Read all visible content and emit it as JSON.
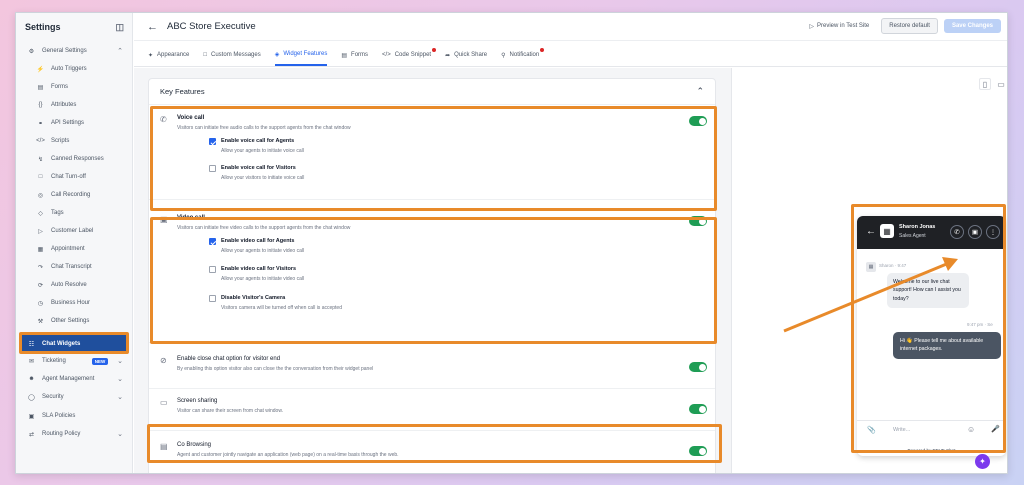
{
  "sidebar": {
    "title": "Settings",
    "items": [
      {
        "label": "General Settings",
        "icon": "gear-icon"
      },
      {
        "label": "Auto Triggers",
        "icon": "bolt-icon"
      },
      {
        "label": "Forms",
        "icon": "form-icon"
      },
      {
        "label": "Attributes",
        "icon": "braces-icon"
      },
      {
        "label": "API Settings",
        "icon": "api-icon"
      },
      {
        "label": "Scripts",
        "icon": "code-icon"
      },
      {
        "label": "Canned Responses",
        "icon": "lightning-icon"
      },
      {
        "label": "Chat Turn-off",
        "icon": "chat-icon"
      },
      {
        "label": "Call Recording",
        "icon": "record-icon"
      },
      {
        "label": "Tags",
        "icon": "tag-icon"
      },
      {
        "label": "Customer Label",
        "icon": "label-icon"
      },
      {
        "label": "Appointment",
        "icon": "calendar-icon"
      },
      {
        "label": "Chat Transcript",
        "icon": "transcript-icon"
      },
      {
        "label": "Auto Resolve",
        "icon": "resolve-icon"
      },
      {
        "label": "Business Hour",
        "icon": "clock-icon"
      },
      {
        "label": "Other Settings",
        "icon": "wrench-icon"
      },
      {
        "label": "Chat Widgets",
        "icon": "widget-icon"
      },
      {
        "label": "Ticketing",
        "icon": "ticket-icon",
        "badge": "NEW"
      },
      {
        "label": "Agent Management",
        "icon": "agents-icon"
      },
      {
        "label": "Security",
        "icon": "shield-icon"
      },
      {
        "label": "SLA Policies",
        "icon": "sla-icon"
      },
      {
        "label": "Routing Policy",
        "icon": "routing-icon"
      }
    ]
  },
  "header": {
    "title": "ABC Store Executive",
    "preview_label": "Preview in Test Site",
    "restore_label": "Restore default",
    "save_label": "Save Changes"
  },
  "tabs": [
    {
      "label": "Appearance"
    },
    {
      "label": "Custom Messages"
    },
    {
      "label": "Widget Features"
    },
    {
      "label": "Forms"
    },
    {
      "label": "Code Snippet"
    },
    {
      "label": "Quick Share"
    },
    {
      "label": "Notification"
    }
  ],
  "key_features": {
    "title": "Key Features",
    "voice": {
      "title": "Voice call",
      "desc": "Visitors can initiate free audio calls to the support agents from the chat window",
      "opt1_title": "Enable voice call for Agents",
      "opt1_desc": "Allow your agents to initiate voice call",
      "opt2_title": "Enable voice call for Visitors",
      "opt2_desc": "Allow your visitors to initiate voice call"
    },
    "video": {
      "title": "Video call",
      "desc": "Visitors can initiate free video calls to the support agents from the chat window",
      "opt1_title": "Enable video call for Agents",
      "opt1_desc": "Allow your agents to initiate video call",
      "opt2_title": "Enable video call for Visitors",
      "opt2_desc": "Allow your agents to initiate video call",
      "opt3_title": "Disable Visitor's Camera",
      "opt3_desc": "Visitors camera will be turned off when call is accepted"
    },
    "close_chat": {
      "title": "Enable close chat option for visitor end",
      "desc": "By enabling this option visitor also can close the the conversation from their widget panel"
    },
    "screen_sharing": {
      "title": "Screen sharing",
      "desc": "Visitor can share their screen from chat window."
    },
    "co_browsing": {
      "title": "Co Browsing",
      "desc": "Agent and customer jointly navigate an application (web page) on a real-time basis through the web."
    }
  },
  "widget": {
    "agent_name": "Sharon Jonas",
    "agent_role": "Sales Agent",
    "msg_in_meta": "Sharon · 9:47",
    "msg_in": "Welcome to our live chat support! How can I assist you today?",
    "msg_out_meta": "9:47 pm · Se",
    "msg_out": "Hi 👋 Please tell me about available internet packages.",
    "input_placeholder": "Write...",
    "footer": "Powered by REVE Chat"
  },
  "colors": {
    "accent": "#2563eb",
    "toggle_on": "#1f9d55",
    "highlight": "#e88a2a",
    "active_sidebar": "#1f4f9d"
  }
}
